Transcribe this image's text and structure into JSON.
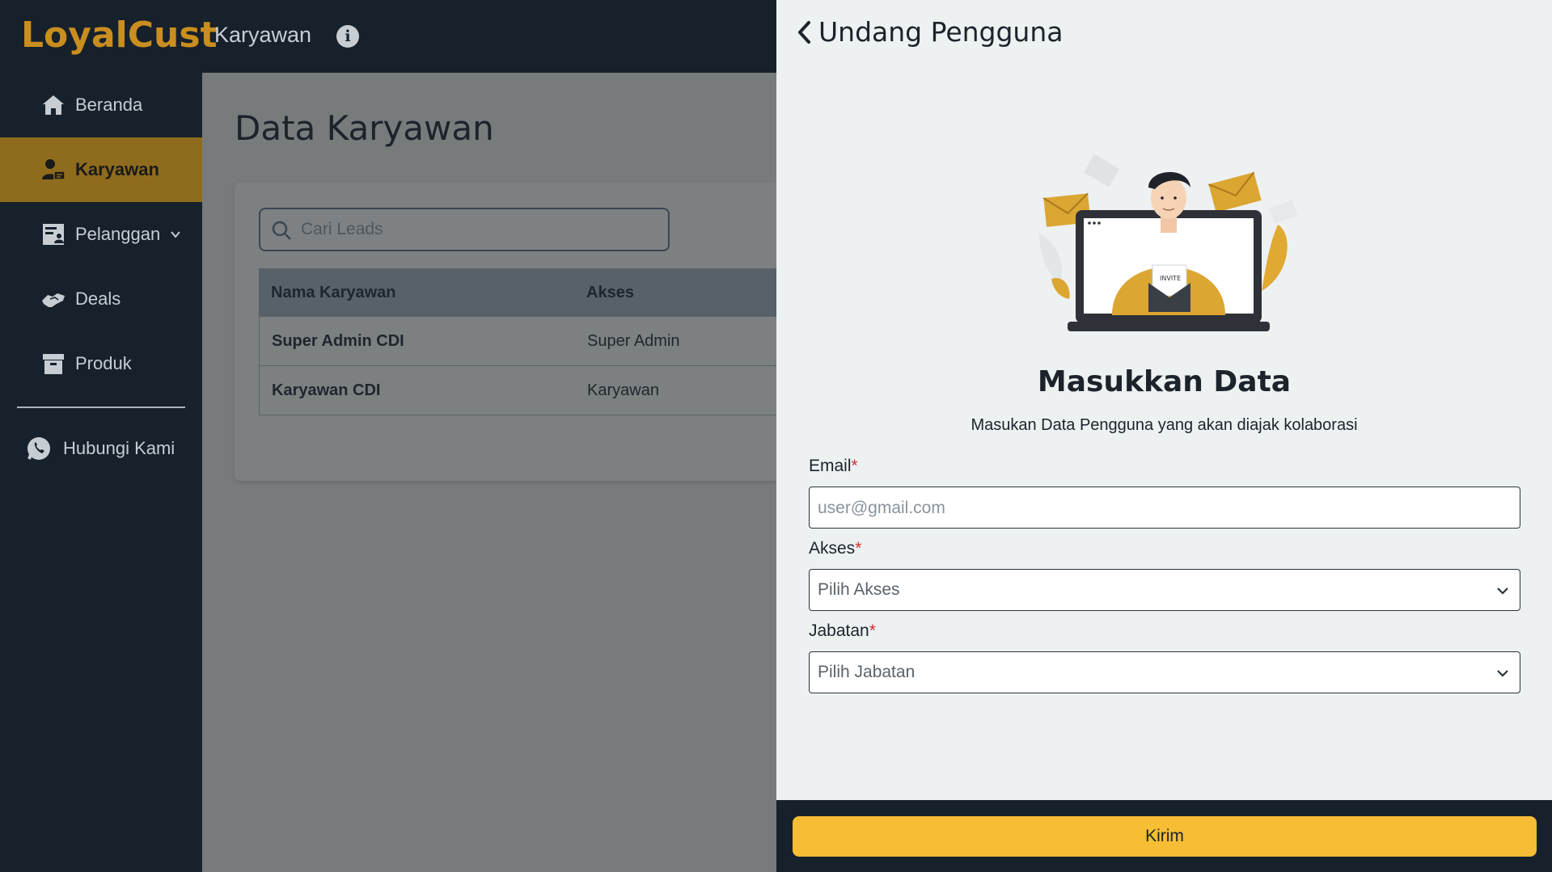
{
  "app": {
    "logo_text": "LoyalCust",
    "section_title": "Karyawan"
  },
  "sidebar": {
    "items": [
      {
        "label": "Beranda",
        "icon": "home-icon"
      },
      {
        "label": "Karyawan",
        "icon": "user-card-icon",
        "active": true
      },
      {
        "label": "Pelanggan",
        "icon": "customer-list-icon",
        "has_submenu": true
      },
      {
        "label": "Deals",
        "icon": "handshake-icon"
      },
      {
        "label": "Produk",
        "icon": "archive-box-icon"
      }
    ],
    "contact": {
      "label": "Hubungi Kami",
      "icon": "whatsapp-icon"
    }
  },
  "main": {
    "title": "Data Karyawan",
    "search": {
      "placeholder": "Cari Leads"
    },
    "table": {
      "headers": [
        "Nama Karyawan",
        "Akses"
      ],
      "rows": [
        [
          "Super Admin CDI",
          "Super Admin"
        ],
        [
          "Karyawan CDI",
          "Karyawan"
        ]
      ]
    }
  },
  "drawer": {
    "title": "Undang Pengguna",
    "heading": "Masukkan Data",
    "subheading": "Masukan Data Pengguna yang akan diajak kolaborasi",
    "illustration_text": "INVITE",
    "fields": {
      "email": {
        "label": "Email",
        "required_mark": "*",
        "placeholder": "user@gmail.com",
        "value": ""
      },
      "akses": {
        "label": "Akses",
        "required_mark": "*",
        "selected": "Pilih Akses"
      },
      "jabatan": {
        "label": "Jabatan",
        "required_mark": "*",
        "selected": "Pilih Jabatan"
      }
    },
    "submit_label": "Kirim"
  },
  "colors": {
    "brand": "#c98e1f",
    "dark": "#17212b",
    "active_nav": "#8f6c1d",
    "button": "#f7bd34",
    "required": "#d32f2f"
  }
}
